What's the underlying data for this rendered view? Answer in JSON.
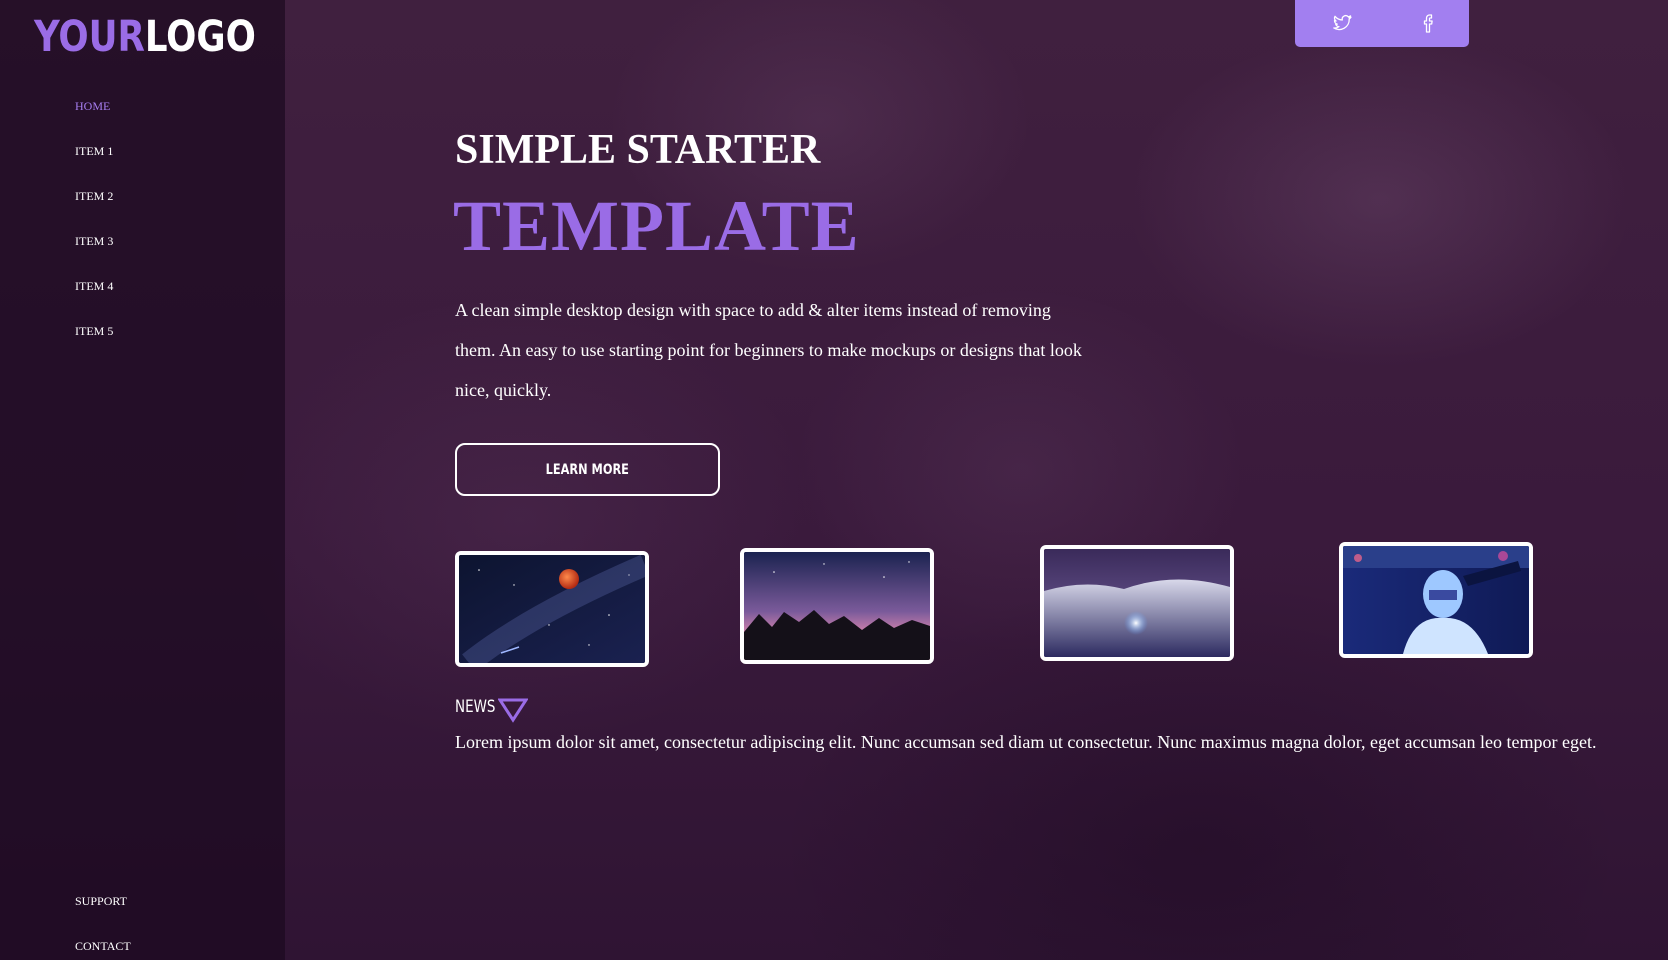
{
  "colors": {
    "accent": "#9a6ce6",
    "accent_light": "#a27ff0",
    "sidebar": "#1c0a20",
    "background": "#3a1a3e"
  },
  "logo": {
    "part1": "YOUR",
    "part2": "LOGO"
  },
  "sidebar": {
    "items": [
      {
        "label": "HOME",
        "active": true
      },
      {
        "label": "ITEM 1"
      },
      {
        "label": "ITEM 2"
      },
      {
        "label": "ITEM 3"
      },
      {
        "label": "ITEM 4"
      },
      {
        "label": "ITEM 5"
      }
    ],
    "bottom_items": [
      {
        "label": "SUPPORT"
      },
      {
        "label": "CONTACT"
      }
    ]
  },
  "social": {
    "icons": [
      "twitter-icon",
      "facebook-icon"
    ]
  },
  "hero": {
    "title_line1": "SIMPLE STARTER",
    "title_line2": "TEMPLATE",
    "description": "A clean simple desktop design with space to add & alter items instead of removing them. An easy to use starting point for beginners to make mockups or designs that look nice, quickly.",
    "button_label": "LEARN MORE"
  },
  "gallery": {
    "items": [
      "red-moon-night-sky",
      "mountain-silhouette-sunset-sky",
      "snowy-hill-night",
      "neon-masked-figure"
    ]
  },
  "news": {
    "label": "NEWS",
    "text": "Lorem ipsum dolor sit amet, consectetur adipiscing elit. Nunc accumsan sed diam ut consectetur. Nunc maximus magna dolor, eget accumsan leo tempor eget."
  }
}
